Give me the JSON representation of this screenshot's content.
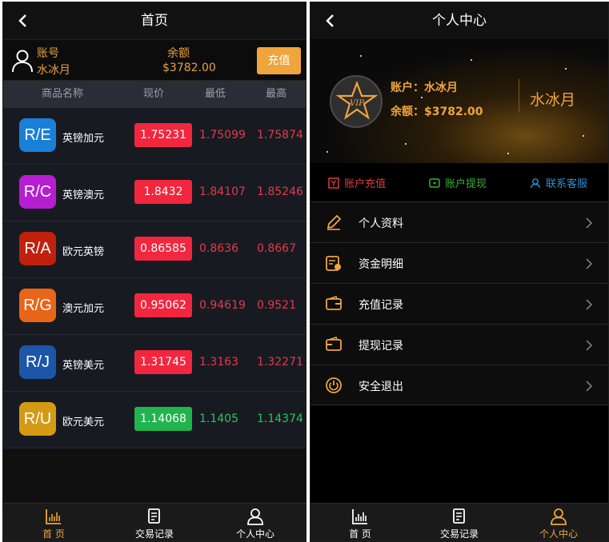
{
  "left": {
    "title": "首页",
    "account": {
      "label": "账号",
      "name": "水冰月",
      "balance_label": "余额",
      "balance": "$3782.00",
      "recharge": "充值"
    },
    "columns": [
      "商品名称",
      "现价",
      "最低",
      "最高"
    ],
    "rows": [
      {
        "code": "R/E",
        "color": "#1a7fd6",
        "name": "英镑加元",
        "price": "1.75231",
        "low": "1.75099",
        "high": "1.75874",
        "dir": "red"
      },
      {
        "code": "R/C",
        "color": "#b51ed1",
        "name": "英镑澳元",
        "price": "1.8432",
        "low": "1.84107",
        "high": "1.85246",
        "dir": "red"
      },
      {
        "code": "R/A",
        "color": "#c0200c",
        "name": "欧元英镑",
        "price": "0.86585",
        "low": "0.8636",
        "high": "0.8667",
        "dir": "red"
      },
      {
        "code": "R/G",
        "color": "#e8651a",
        "name": "澳元加元",
        "price": "0.95062",
        "low": "0.94619",
        "high": "0.9521",
        "dir": "red"
      },
      {
        "code": "R/J",
        "color": "#1c56a8",
        "name": "英镑美元",
        "price": "1.31745",
        "low": "1.3163",
        "high": "1.32271",
        "dir": "red"
      },
      {
        "code": "R/U",
        "color": "#d49a14",
        "name": "欧元美元",
        "price": "1.14068",
        "low": "1.1405",
        "high": "1.14374",
        "dir": "green"
      }
    ],
    "tabs": [
      "首 页",
      "交易记录",
      "个人中心"
    ]
  },
  "right": {
    "title": "个人中心",
    "vip_text": "VIP",
    "account_line": "账户：水冰月",
    "balance_line": "余额：$3782.00",
    "username": "水冰月",
    "actions": [
      {
        "label": "账户充值",
        "color": "#e03a3a",
        "icon": "recharge-icon"
      },
      {
        "label": "账户提现",
        "color": "#38b03a",
        "icon": "withdraw-icon"
      },
      {
        "label": "联系客服",
        "color": "#2a8fd8",
        "icon": "support-icon"
      }
    ],
    "menu": [
      {
        "label": "个人资料",
        "icon": "pencil-icon"
      },
      {
        "label": "资金明细",
        "icon": "funds-icon"
      },
      {
        "label": "充值记录",
        "icon": "wallet-in-icon"
      },
      {
        "label": "提现记录",
        "icon": "wallet-out-icon"
      },
      {
        "label": "安全退出",
        "icon": "power-icon"
      }
    ],
    "tabs": [
      "首 页",
      "交易记录",
      "个人中心"
    ]
  },
  "colors": {
    "accent": "#f0a43c",
    "red": "#f2263e",
    "green": "#1fb44d"
  }
}
